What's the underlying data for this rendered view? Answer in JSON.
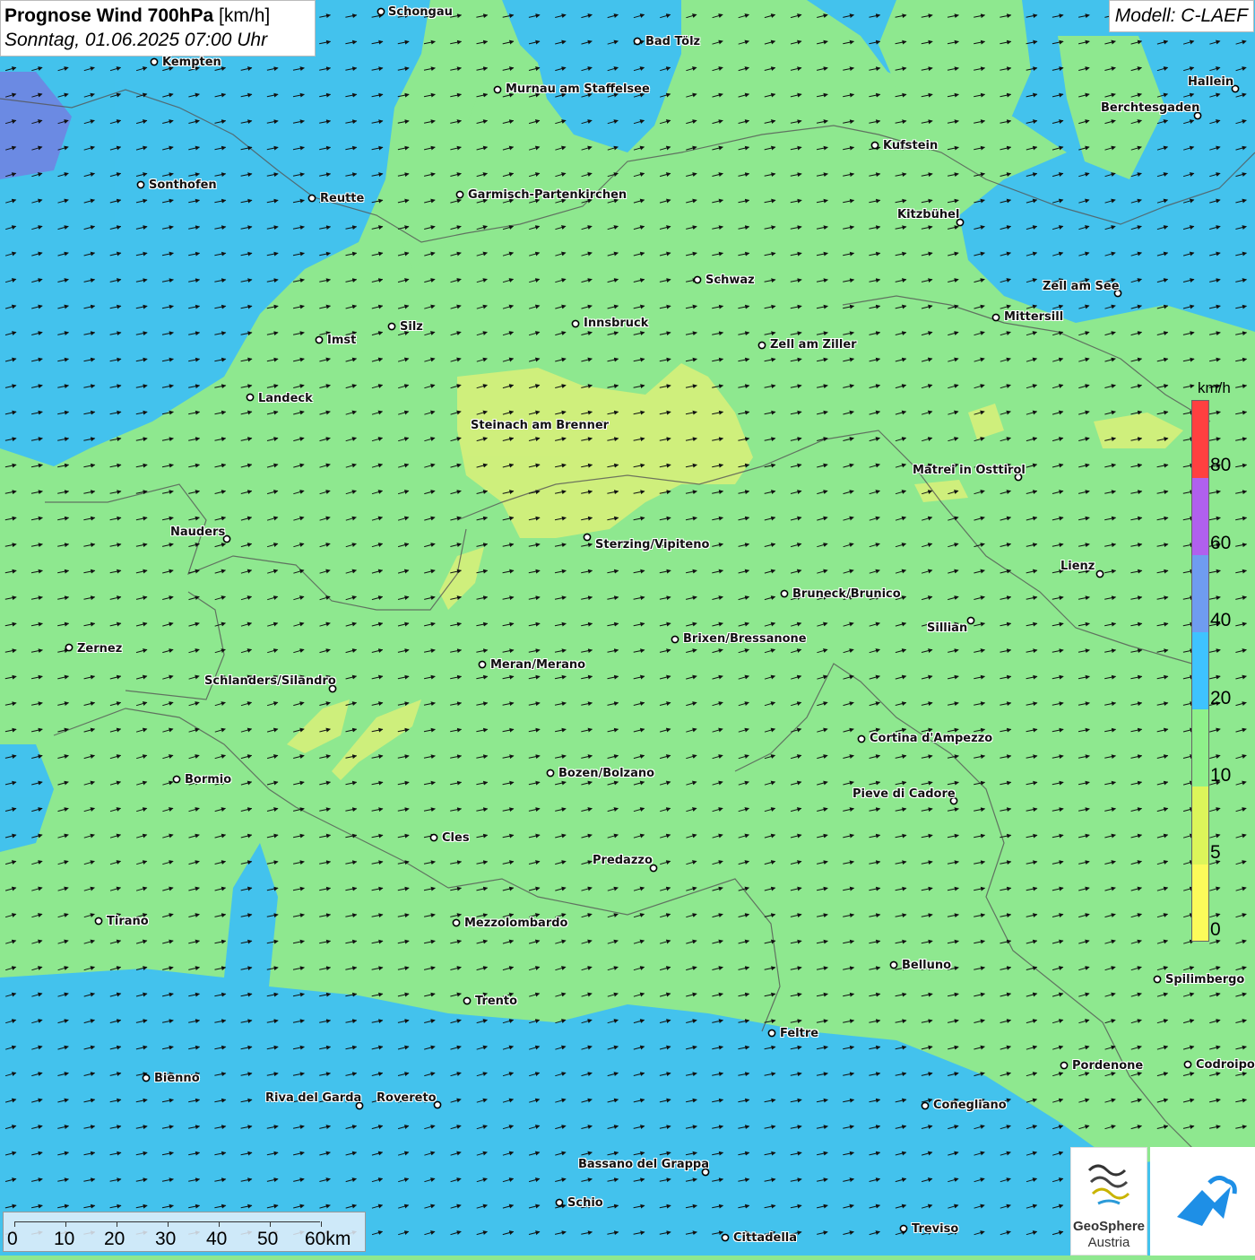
{
  "header": {
    "title_bold": "Prognose Wind 700hPa",
    "title_unit": "[km/h]",
    "datetime": "Sonntag, 01.06.2025 07:00 Uhr",
    "model": "Modell: C-LAEF"
  },
  "legend": {
    "unit": "km/h",
    "labels": [
      "80",
      "60",
      "40",
      "20",
      "10",
      "5",
      "0"
    ],
    "colors": [
      "#ff4040",
      "#b060ee",
      "#6f9cf0",
      "#3ec3ff",
      "#8ef08a",
      "#dcf55a",
      "#fcfb5a"
    ]
  },
  "scale_bar": {
    "labels": [
      "0",
      "10",
      "20",
      "30",
      "40",
      "50",
      "60km"
    ]
  },
  "cities": [
    {
      "name": "Schongau"
    },
    {
      "name": "Bad Tölz"
    },
    {
      "name": "Kempten"
    },
    {
      "name": "Murnau am Staffelsee"
    },
    {
      "name": "Hallein"
    },
    {
      "name": "Berchtesgaden"
    },
    {
      "name": "Kufstein"
    },
    {
      "name": "Sonthofen"
    },
    {
      "name": "Reutte"
    },
    {
      "name": "Garmisch-Partenkirchen"
    },
    {
      "name": "Kitzbühel"
    },
    {
      "name": "Schwaz"
    },
    {
      "name": "Zell am See"
    },
    {
      "name": "Mittersill"
    },
    {
      "name": "Innsbruck"
    },
    {
      "name": "Silz"
    },
    {
      "name": "Imst"
    },
    {
      "name": "Zell am Ziller"
    },
    {
      "name": "Landeck"
    },
    {
      "name": "Steinach am Brenner"
    },
    {
      "name": "Matrei in Osttirol"
    },
    {
      "name": "Nauders"
    },
    {
      "name": "Sterzing/Vipiteno"
    },
    {
      "name": "Lienz"
    },
    {
      "name": "Bruneck/Brunico"
    },
    {
      "name": "Sillian"
    },
    {
      "name": "Zernez"
    },
    {
      "name": "Brixen/Bressanone"
    },
    {
      "name": "Meran/Merano"
    },
    {
      "name": "Schlanders/Silandro"
    },
    {
      "name": "Cortina d'Ampezzo"
    },
    {
      "name": "Bozen/Bolzano"
    },
    {
      "name": "Bormio"
    },
    {
      "name": "Pieve di Cadore"
    },
    {
      "name": "Cles"
    },
    {
      "name": "Predazzo"
    },
    {
      "name": "Tirano"
    },
    {
      "name": "Mezzolombardo"
    },
    {
      "name": "Belluno"
    },
    {
      "name": "Spilimbergo"
    },
    {
      "name": "Trento"
    },
    {
      "name": "Feltre"
    },
    {
      "name": "Pordenone"
    },
    {
      "name": "Codroipo"
    },
    {
      "name": "Bienno"
    },
    {
      "name": "Riva del Garda"
    },
    {
      "name": "Rovereto"
    },
    {
      "name": "Conegliano"
    },
    {
      "name": "Bassano del Grappa"
    },
    {
      "name": "Schio"
    },
    {
      "name": "Treviso"
    },
    {
      "name": "Cittadella"
    }
  ],
  "logos": {
    "geosphere_line1": "GeoSphere",
    "geosphere_line2": "Austria"
  }
}
